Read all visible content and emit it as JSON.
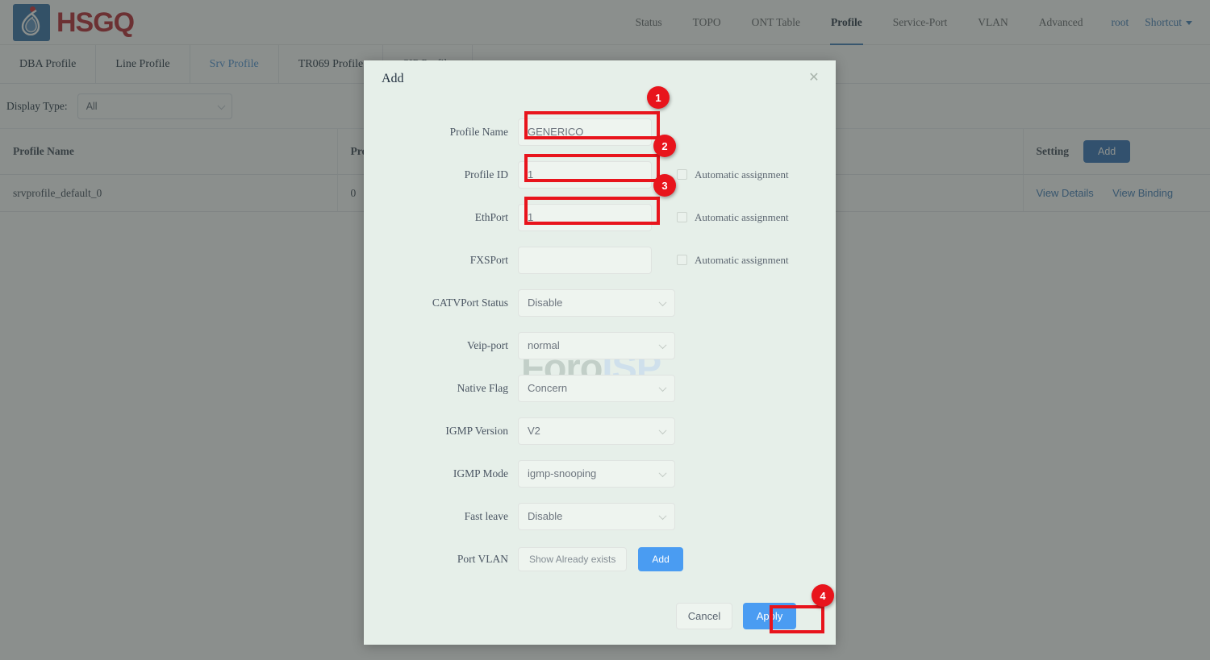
{
  "brand": {
    "name": "HSGQ",
    "logo_icon": "hsgq-droplet-logo"
  },
  "topnav": {
    "items": [
      {
        "label": "Status",
        "active": false
      },
      {
        "label": "TOPO",
        "active": false
      },
      {
        "label": "ONT Table",
        "active": false
      },
      {
        "label": "Profile",
        "active": true
      },
      {
        "label": "Service-Port",
        "active": false
      },
      {
        "label": "VLAN",
        "active": false
      },
      {
        "label": "Advanced",
        "active": false
      }
    ],
    "user": "root",
    "shortcut": "Shortcut"
  },
  "tabs": [
    {
      "label": "DBA Profile",
      "active": false
    },
    {
      "label": "Line Profile",
      "active": false
    },
    {
      "label": "Srv Profile",
      "active": true
    },
    {
      "label": "TR069 Profile",
      "active": false
    },
    {
      "label": "SIP Profile",
      "active": false
    }
  ],
  "filter": {
    "label": "Display Type:",
    "value": "All"
  },
  "table": {
    "columns": [
      "Profile Name",
      "Profile ID",
      "Setting"
    ],
    "setting_add_label": "Add",
    "rows": [
      {
        "profile_name": "srvprofile_default_0",
        "profile_id": "0",
        "actions": [
          "View Details",
          "View Binding"
        ]
      }
    ]
  },
  "dialog": {
    "title": "Add",
    "close_icon": "close-icon",
    "fields": {
      "profile_name": {
        "label": "Profile Name",
        "value": "GENERICO"
      },
      "profile_id": {
        "label": "Profile ID",
        "value": "1",
        "auto_label": "Automatic assignment",
        "auto_checked": false
      },
      "ethport": {
        "label": "EthPort",
        "value": "1",
        "auto_label": "Automatic assignment",
        "auto_checked": false
      },
      "fxsport": {
        "label": "FXSPort",
        "value": "",
        "auto_label": "Automatic assignment",
        "auto_checked": false
      },
      "catvport_status": {
        "label": "CATVPort Status",
        "value": "Disable"
      },
      "veip_port": {
        "label": "Veip-port",
        "value": "normal"
      },
      "native_flag": {
        "label": "Native Flag",
        "value": "Concern"
      },
      "igmp_version": {
        "label": "IGMP Version",
        "value": "V2"
      },
      "igmp_mode": {
        "label": "IGMP Mode",
        "value": "igmp-snooping"
      },
      "fast_leave": {
        "label": "Fast leave",
        "value": "Disable"
      },
      "port_vlan": {
        "label": "Port VLAN",
        "show_label": "Show Already exists",
        "add_label": "Add"
      }
    },
    "footer": {
      "cancel": "Cancel",
      "apply": "Apply"
    }
  },
  "annotations": {
    "accent_color": "#e8141c",
    "steps": [
      {
        "number": "1",
        "target": "profile-name-input"
      },
      {
        "number": "2",
        "target": "profile-id-input"
      },
      {
        "number": "3",
        "target": "ethport-input"
      },
      {
        "number": "4",
        "target": "apply-button"
      }
    ]
  },
  "watermark": {
    "part1": "Foro",
    "part2": "ISP"
  }
}
